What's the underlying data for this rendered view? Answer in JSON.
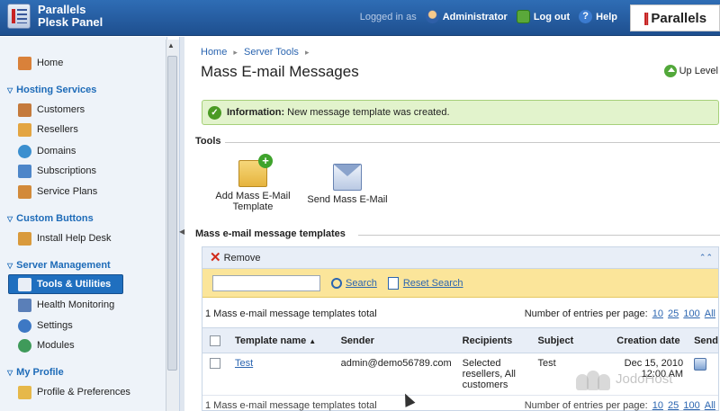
{
  "header": {
    "app_name_line1": "Parallels",
    "app_name_line2": "Plesk Panel",
    "logged_in_label": "Logged in as",
    "user": "Administrator",
    "logout": "Log out",
    "help": "Help",
    "brand": "Parallels"
  },
  "sidebar": {
    "home": "Home",
    "sections": [
      {
        "title": "Hosting Services",
        "items": [
          "Customers",
          "Resellers",
          "Domains",
          "Subscriptions",
          "Service Plans"
        ]
      },
      {
        "title": "Custom Buttons",
        "items": [
          "Install Help Desk"
        ]
      },
      {
        "title": "Server Management",
        "items": [
          "Tools & Utilities",
          "Health Monitoring",
          "Settings",
          "Modules"
        ]
      },
      {
        "title": "My Profile",
        "items": [
          "Profile & Preferences"
        ]
      }
    ]
  },
  "breadcrumb": [
    "Home",
    "Server Tools"
  ],
  "page": {
    "title": "Mass E-mail Messages",
    "up_level": "Up Level"
  },
  "info": {
    "label": "Information:",
    "message": "New message template was created."
  },
  "tools": {
    "heading": "Tools",
    "add_line1": "Add Mass E-Mail",
    "add_line2": "Template",
    "send": "Send Mass E-Mail"
  },
  "templates": {
    "heading": "Mass e-mail message templates",
    "remove": "Remove",
    "search_value": "",
    "search": "Search",
    "reset_search": "Reset Search",
    "total": "1 Mass e-mail message templates total",
    "per_page_label": "Number of entries per page:",
    "per_page_options": [
      "10",
      "25",
      "100",
      "All"
    ],
    "columns": [
      "Template name",
      "Sender",
      "Recipients",
      "Subject",
      "Creation date",
      "Send"
    ],
    "rows": [
      {
        "name": "Test",
        "sender": "admin@demo56789.com",
        "recipients_line1": "Selected",
        "recipients_line2": "resellers, All",
        "recipients_line3": "customers",
        "subject": "Test",
        "date_line1": "Dec 15, 2010",
        "date_line2": "12:00 AM"
      }
    ]
  },
  "watermark": "JodoHost"
}
